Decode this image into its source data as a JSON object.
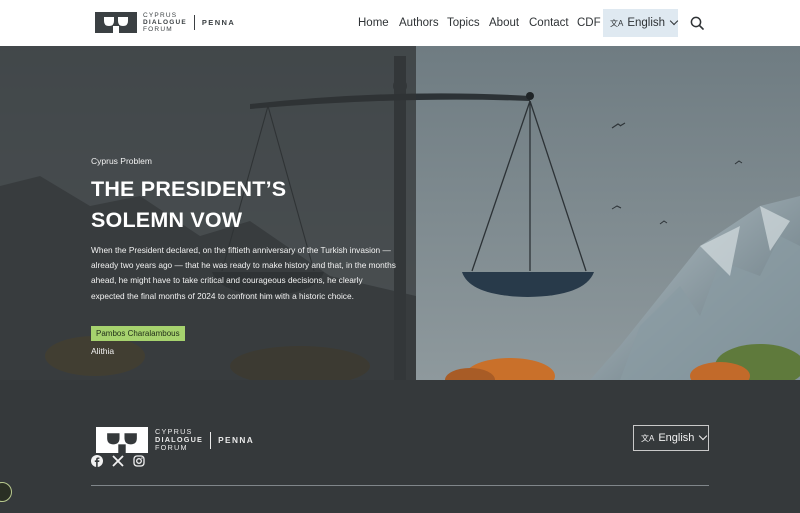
{
  "brand": {
    "line1": "CYPRUS",
    "line2": "DIALOGUE",
    "line3": "FORUM",
    "penna": "PENNA"
  },
  "nav": {
    "items": [
      {
        "label": "Home"
      },
      {
        "label": "Authors"
      },
      {
        "label": "Topics"
      },
      {
        "label": "About"
      },
      {
        "label": "Contact"
      },
      {
        "label": "CDF"
      }
    ],
    "language": {
      "glyph": "文A",
      "label": "English"
    },
    "search_icon": "search-icon"
  },
  "hero": {
    "category": "Cyprus Problem",
    "title_line1": "THE PRESIDENT’S",
    "title_line2": "SOLEMN VOW",
    "excerpt": "When the President declared, on the fiftieth anniversary of the Turkish invasion — already two years ago — that he was ready to make history and that, in the months ahead, he might have to take critical and courageous decisions, he clearly expected the final months of 2024 to confront him with a historic choice.",
    "author": "Pambos Charalambous",
    "source": "Alithia",
    "image_subject": "balance-scale-illustration"
  },
  "footer": {
    "social": [
      "facebook-icon",
      "x-icon",
      "instagram-icon"
    ],
    "language": {
      "glyph": "文A",
      "label": "English"
    }
  },
  "colors": {
    "header_bg": "#ffffff",
    "footer_bg": "#35393b",
    "lang_button_bg": "#dfe9f1",
    "author_tag_bg": "#a6d26e",
    "hero_overlay": "#303335"
  }
}
